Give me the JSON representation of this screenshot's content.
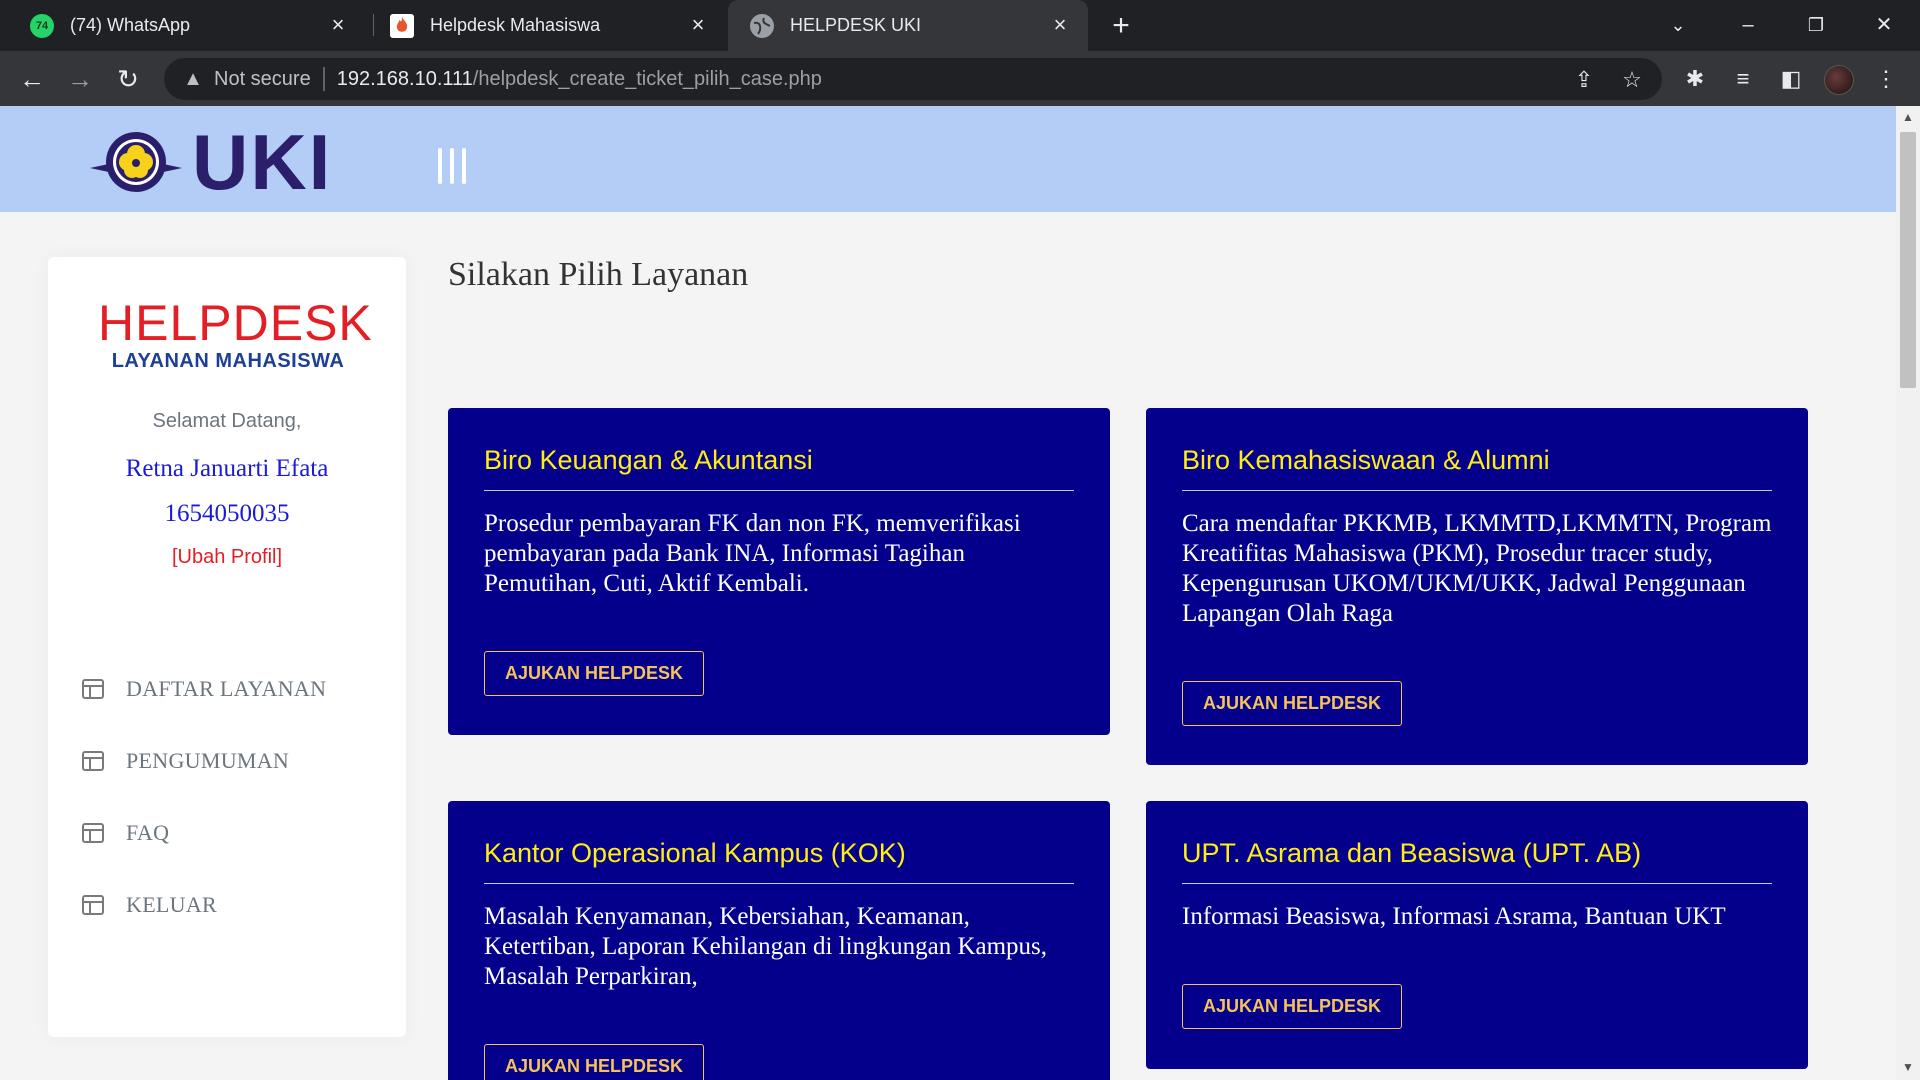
{
  "browser": {
    "tabs": [
      {
        "title": "(74) WhatsApp",
        "favicon": "whatsapp-icon",
        "badge": "74"
      },
      {
        "title": "Helpdesk Mahasiswa",
        "favicon": "flame-icon"
      },
      {
        "title": "HELPDESK UKI",
        "favicon": "globe-icon",
        "active": true
      }
    ],
    "security_label": "Not secure",
    "url_host": "192.168.10.111",
    "url_path": "/helpdesk_create_ticket_pilih_case.php"
  },
  "header": {
    "logo_text": "UKI"
  },
  "sidebar": {
    "logo_title": "HELPDESK",
    "logo_subtitle": "LAYANAN MAHASISWA",
    "welcome": "Selamat Datang,",
    "user_name": "Retna Januarti Efata",
    "user_id": "1654050035",
    "edit_profile_open": "[",
    "edit_profile_label": "Ubah Profil",
    "edit_profile_close": "]",
    "menu": [
      {
        "label": "DAFTAR LAYANAN"
      },
      {
        "label": "PENGUMUMAN"
      },
      {
        "label": "FAQ"
      },
      {
        "label": "KELUAR"
      }
    ]
  },
  "main": {
    "title": "Silakan Pilih Layanan",
    "cards": [
      {
        "title": "Biro Keuangan & Akuntansi",
        "description": "Prosedur pembayaran FK dan non FK, memverifikasi pembayaran pada Bank INA, Informasi Tagihan Pemutihan, Cuti, Aktif Kembali.",
        "button": "AJUKAN HELPDESK"
      },
      {
        "title": "Biro Kemahasiswaan & Alumni",
        "description": "Cara mendaftar PKKMB, LKMMTD,LKMMTN, Program Kreatifitas Mahasiswa (PKM), Prosedur tracer study, Kepengurusan UKOM/UKM/UKK, Jadwal Penggunaan Lapangan Olah Raga",
        "button": "AJUKAN HELPDESK"
      },
      {
        "title": "Kantor Operasional Kampus (KOK)",
        "description": "Masalah Kenyamanan, Kebersiahan, Keamanan, Ketertiban, Laporan Kehilangan di lingkungan Kampus, Masalah Perparkiran,",
        "button": "AJUKAN HELPDESK"
      },
      {
        "title": "UPT. Asrama dan Beasiswa (UPT. AB)",
        "description": "Informasi Beasiswa, Informasi Asrama, Bantuan UKT",
        "button": "AJUKAN HELPDESK"
      }
    ]
  },
  "colors": {
    "header_bg": "#b3cdf7",
    "card_bg": "#04008c",
    "card_title": "#ffee11",
    "card_button": "#f5c35a",
    "helpdesk_red": "#e31e24",
    "helpdesk_blue": "#1d3f96",
    "user_blue": "#1b1bd6"
  }
}
